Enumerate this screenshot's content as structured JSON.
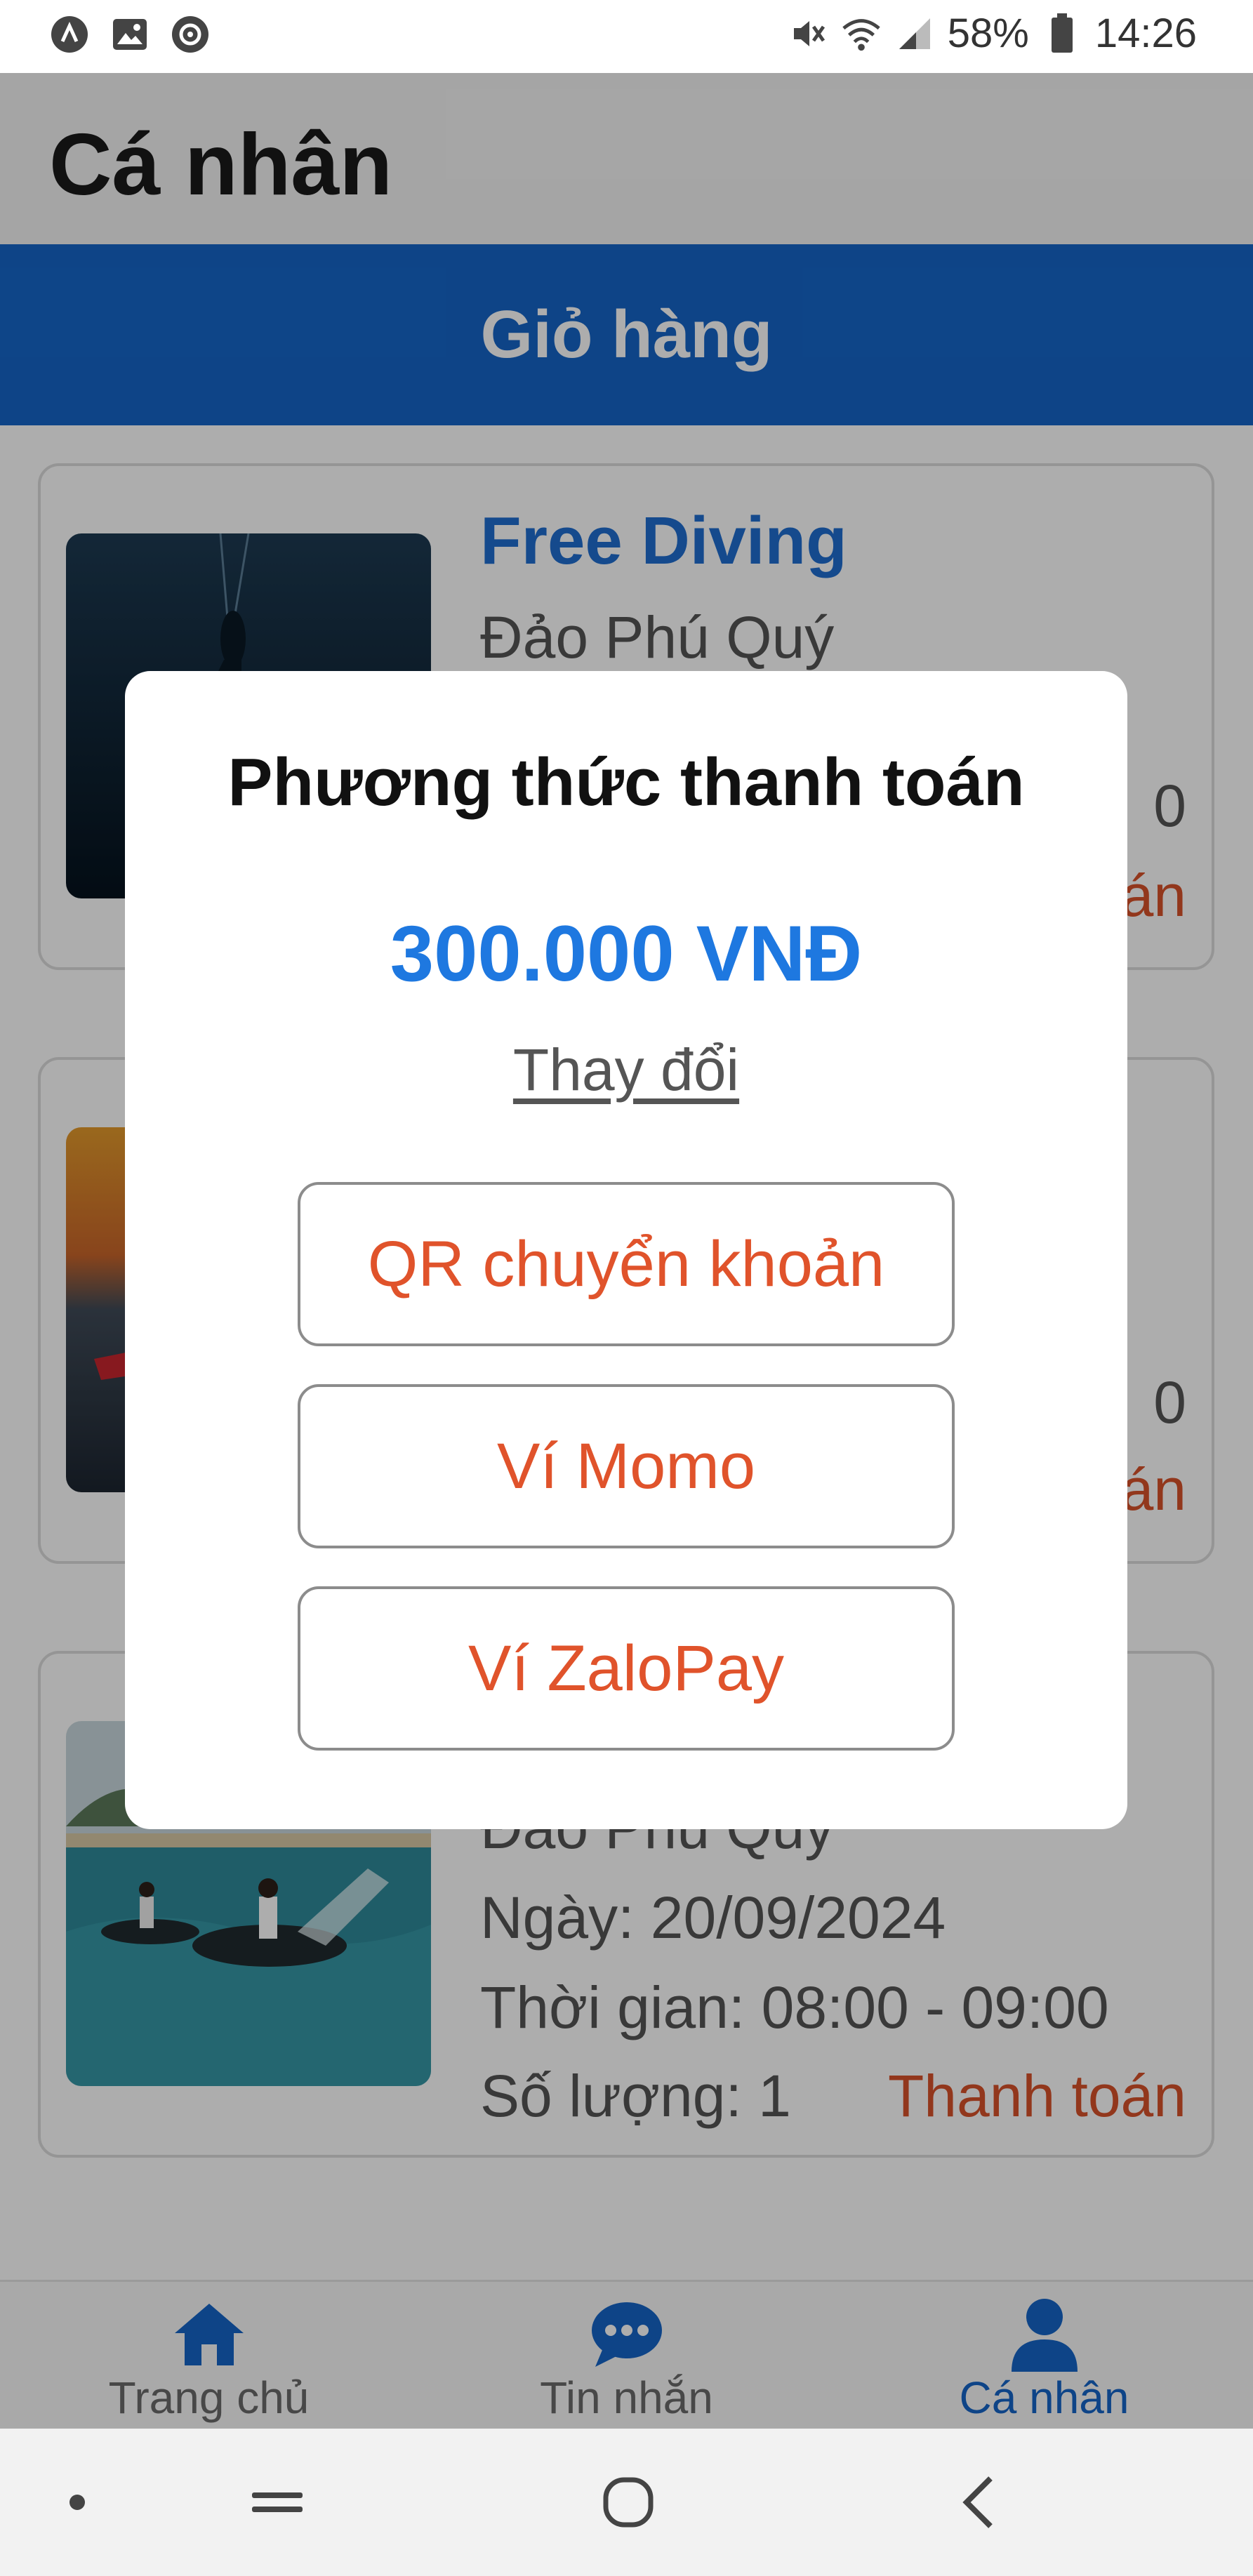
{
  "status_bar": {
    "battery": "58%",
    "time": "14:26"
  },
  "header": {
    "title": "Cá nhân"
  },
  "section_bar": {
    "label": "Giỏ hàng"
  },
  "cart": {
    "items": [
      {
        "title": "Free Diving",
        "location": "Đảo Phú Quý",
        "trailing_1": "0",
        "pay_fragment": "án"
      },
      {
        "trailing_1": "0",
        "pay_fragment": "án"
      },
      {
        "location": "Đảo Phú Quý",
        "date": "Ngày: 20/09/2024",
        "time": "Thời gian: 08:00 - 09:00",
        "quantity": "Số lượng: 1",
        "pay_label": "Thanh toán"
      }
    ]
  },
  "payment_modal": {
    "title": "Phương thức thanh toán",
    "amount": "300.000 VNĐ",
    "change_link": "Thay đổi",
    "options": [
      "QR chuyển khoản",
      "Ví Momo",
      "Ví ZaloPay"
    ]
  },
  "bottom_nav": {
    "items": [
      {
        "label": "Trang chủ",
        "icon": "home-icon"
      },
      {
        "label": "Tin nhắn",
        "icon": "chat-icon"
      },
      {
        "label": "Cá nhân",
        "icon": "person-icon",
        "active": true
      }
    ]
  },
  "colors": {
    "primary_blue": "#1565c8",
    "title_blue": "#1f6dd0",
    "amount_blue": "#1e78e0",
    "pay_red": "#d8512a",
    "option_red": "#e0532b"
  }
}
